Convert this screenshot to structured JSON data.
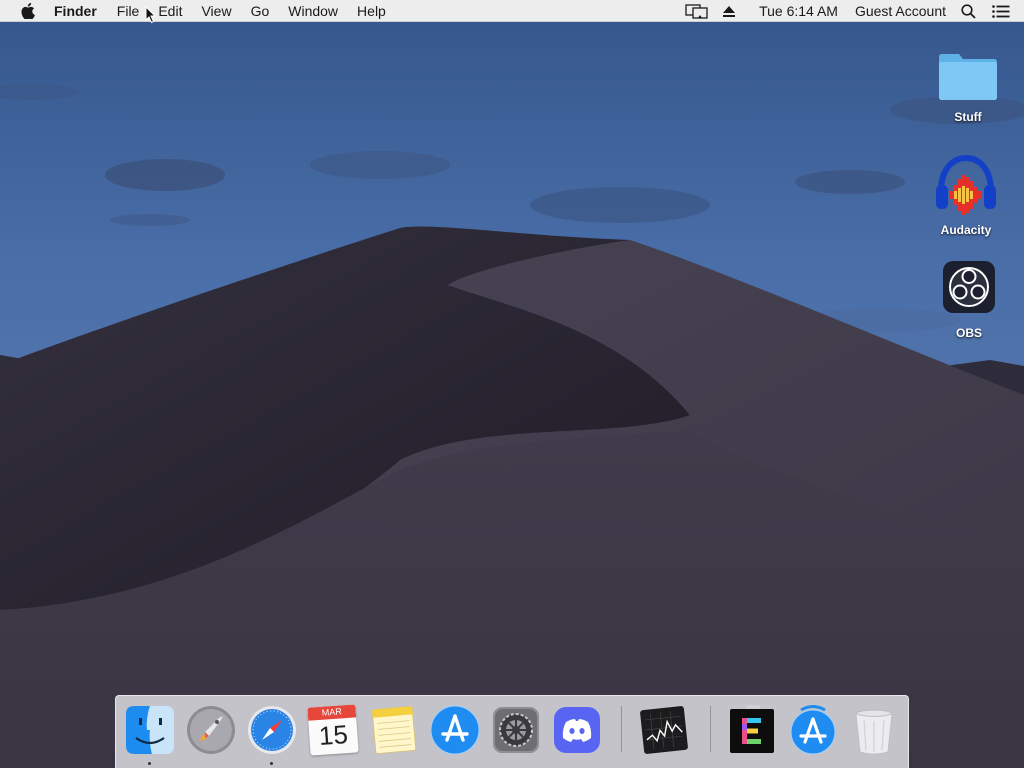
{
  "menubar": {
    "app_name": "Finder",
    "items": [
      "File",
      "Edit",
      "View",
      "Go",
      "Window",
      "Help"
    ],
    "clock": "Tue 6:14 AM",
    "user": "Guest Account"
  },
  "desktop": {
    "icons": [
      {
        "label": "Stuff",
        "icon": "folder-icon"
      },
      {
        "label": "Audacity",
        "icon": "audacity-icon"
      },
      {
        "label": "OBS",
        "icon": "obs-icon"
      }
    ]
  },
  "dock": {
    "apps": [
      {
        "name": "Finder",
        "icon": "finder-icon",
        "running": true
      },
      {
        "name": "Launchpad",
        "icon": "launchpad-icon",
        "running": false
      },
      {
        "name": "Safari",
        "icon": "safari-icon",
        "running": true
      },
      {
        "name": "Calendar",
        "icon": "calendar-icon",
        "running": false
      },
      {
        "name": "Notes",
        "icon": "notes-icon",
        "running": false
      },
      {
        "name": "App Store",
        "icon": "app-store-icon",
        "running": false
      },
      {
        "name": "System Preferences",
        "icon": "system-preferences-icon",
        "running": false
      },
      {
        "name": "Discord",
        "icon": "discord-icon",
        "running": false
      },
      {
        "name": "Stocks",
        "icon": "stocks-icon",
        "running": false
      },
      {
        "name": "E App",
        "icon": "e-app-icon",
        "running": false
      },
      {
        "name": "App Store Downloads",
        "icon": "app-store-downloads-icon",
        "running": false
      },
      {
        "name": "Trash",
        "icon": "trash-icon",
        "running": false
      }
    ],
    "calendar": {
      "month": "MAR",
      "day": "15"
    }
  },
  "colors": {
    "menubar_bg": "#ededed",
    "sky_top": "#3a5c95",
    "dune_dark": "#2a2733"
  }
}
